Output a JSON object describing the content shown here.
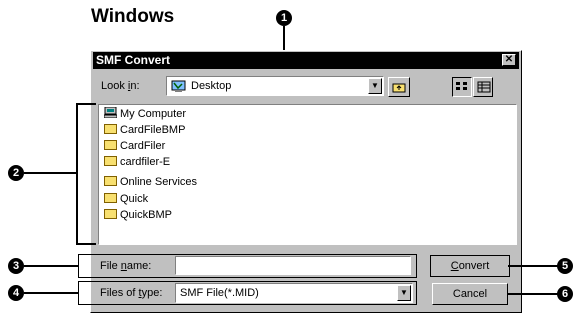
{
  "heading": "Windows",
  "dialog": {
    "title": "SMF Convert",
    "close_glyph": "✕",
    "look_in_label_pre": "Look ",
    "look_in_label_u": "i",
    "look_in_label_post": "n:",
    "look_in_value": "Desktop",
    "look_in_icon": "desktop-icon",
    "file_list": [
      {
        "label": "My Computer",
        "icon": "computer-icon"
      },
      {
        "label": "CardFileBMP",
        "icon": "folder-icon"
      },
      {
        "label": "CardFiler",
        "icon": "folder-icon"
      },
      {
        "label": "cardfiler-E",
        "icon": "folder-icon"
      },
      {
        "label": "Online Services",
        "icon": "folder-icon"
      },
      {
        "label": "Quick",
        "icon": "folder-icon"
      },
      {
        "label": "QuickBMP",
        "icon": "folder-icon"
      }
    ],
    "file_name_label_pre": "File ",
    "file_name_label_u": "n",
    "file_name_label_post": "ame:",
    "file_name_value": "",
    "files_of_type_label_pre": "Files of ",
    "files_of_type_label_u": "t",
    "files_of_type_label_post": "ype:",
    "files_of_type_value": "SMF File(*.MID)",
    "convert_pre": "",
    "convert_u": "C",
    "convert_post": "onvert",
    "cancel_label": "Cancel"
  },
  "callouts": [
    "1",
    "2",
    "3",
    "4",
    "5",
    "6"
  ],
  "colors": {
    "dialog_face": "#c0c0c0",
    "titlebar": "#000000",
    "folder": "#f8e070"
  }
}
